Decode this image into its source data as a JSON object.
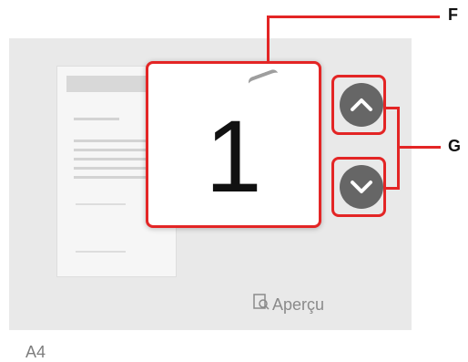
{
  "screen": {
    "page_number": "1",
    "preview_label": "Aperçu",
    "paper_size": "A4",
    "preview_icon": "magnifier-page-icon",
    "up_arrow_icon": "chevron-up-icon",
    "down_arrow_icon": "chevron-down-icon",
    "accent_color": "#e32525"
  },
  "callouts": {
    "f": "F",
    "g": "G"
  }
}
